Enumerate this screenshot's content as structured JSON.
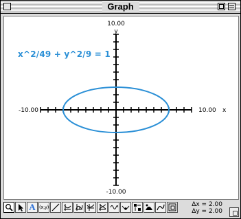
{
  "window": {
    "title": "Graph"
  },
  "graph": {
    "equation": "x^2/49 + y^2/9 = 1",
    "x_axis_name": "x",
    "y_axis_name": "y",
    "x_min_label": "-10.00",
    "x_max_label": "10.00",
    "y_min_label": "-10.00",
    "y_max_label": "10.00",
    "x_range": [
      -10,
      10
    ],
    "y_range": [
      -10,
      10
    ],
    "tick_step": 1,
    "ellipse": {
      "a": 7,
      "b": 3
    },
    "curve_color": "#2a8fd6"
  },
  "status": {
    "dx": "Δx = 2.00",
    "dy": "Δy = 2.00"
  },
  "toolbar": {
    "tools": [
      {
        "name": "zoom-tool",
        "icon": "magnifier-icon"
      },
      {
        "name": "select-tool",
        "icon": "arrow-cursor-icon"
      },
      {
        "name": "text-tool",
        "icon": "letter-a-icon",
        "label": "A"
      },
      {
        "name": "point-tool",
        "icon": "point-xy-icon",
        "label": "(x,y)"
      },
      {
        "name": "line-tool",
        "icon": "line-icon"
      },
      {
        "name": "derivative-tool",
        "icon": "derivative-icon"
      },
      {
        "name": "integral-tool",
        "icon": "integral-icon"
      },
      {
        "name": "trace-tool",
        "icon": "trace-icon"
      },
      {
        "name": "intersect-tool",
        "icon": "intersect-icon"
      },
      {
        "name": "wave-tool",
        "icon": "wave-icon"
      },
      {
        "name": "tangent-tool",
        "icon": "tangent-icon"
      },
      {
        "name": "scale-tool",
        "icon": "scale-icon"
      },
      {
        "name": "shade-tool",
        "icon": "shade-icon"
      },
      {
        "name": "curve-tool",
        "icon": "curve-icon"
      },
      {
        "name": "frame-tool",
        "icon": "frame-icon"
      }
    ]
  }
}
